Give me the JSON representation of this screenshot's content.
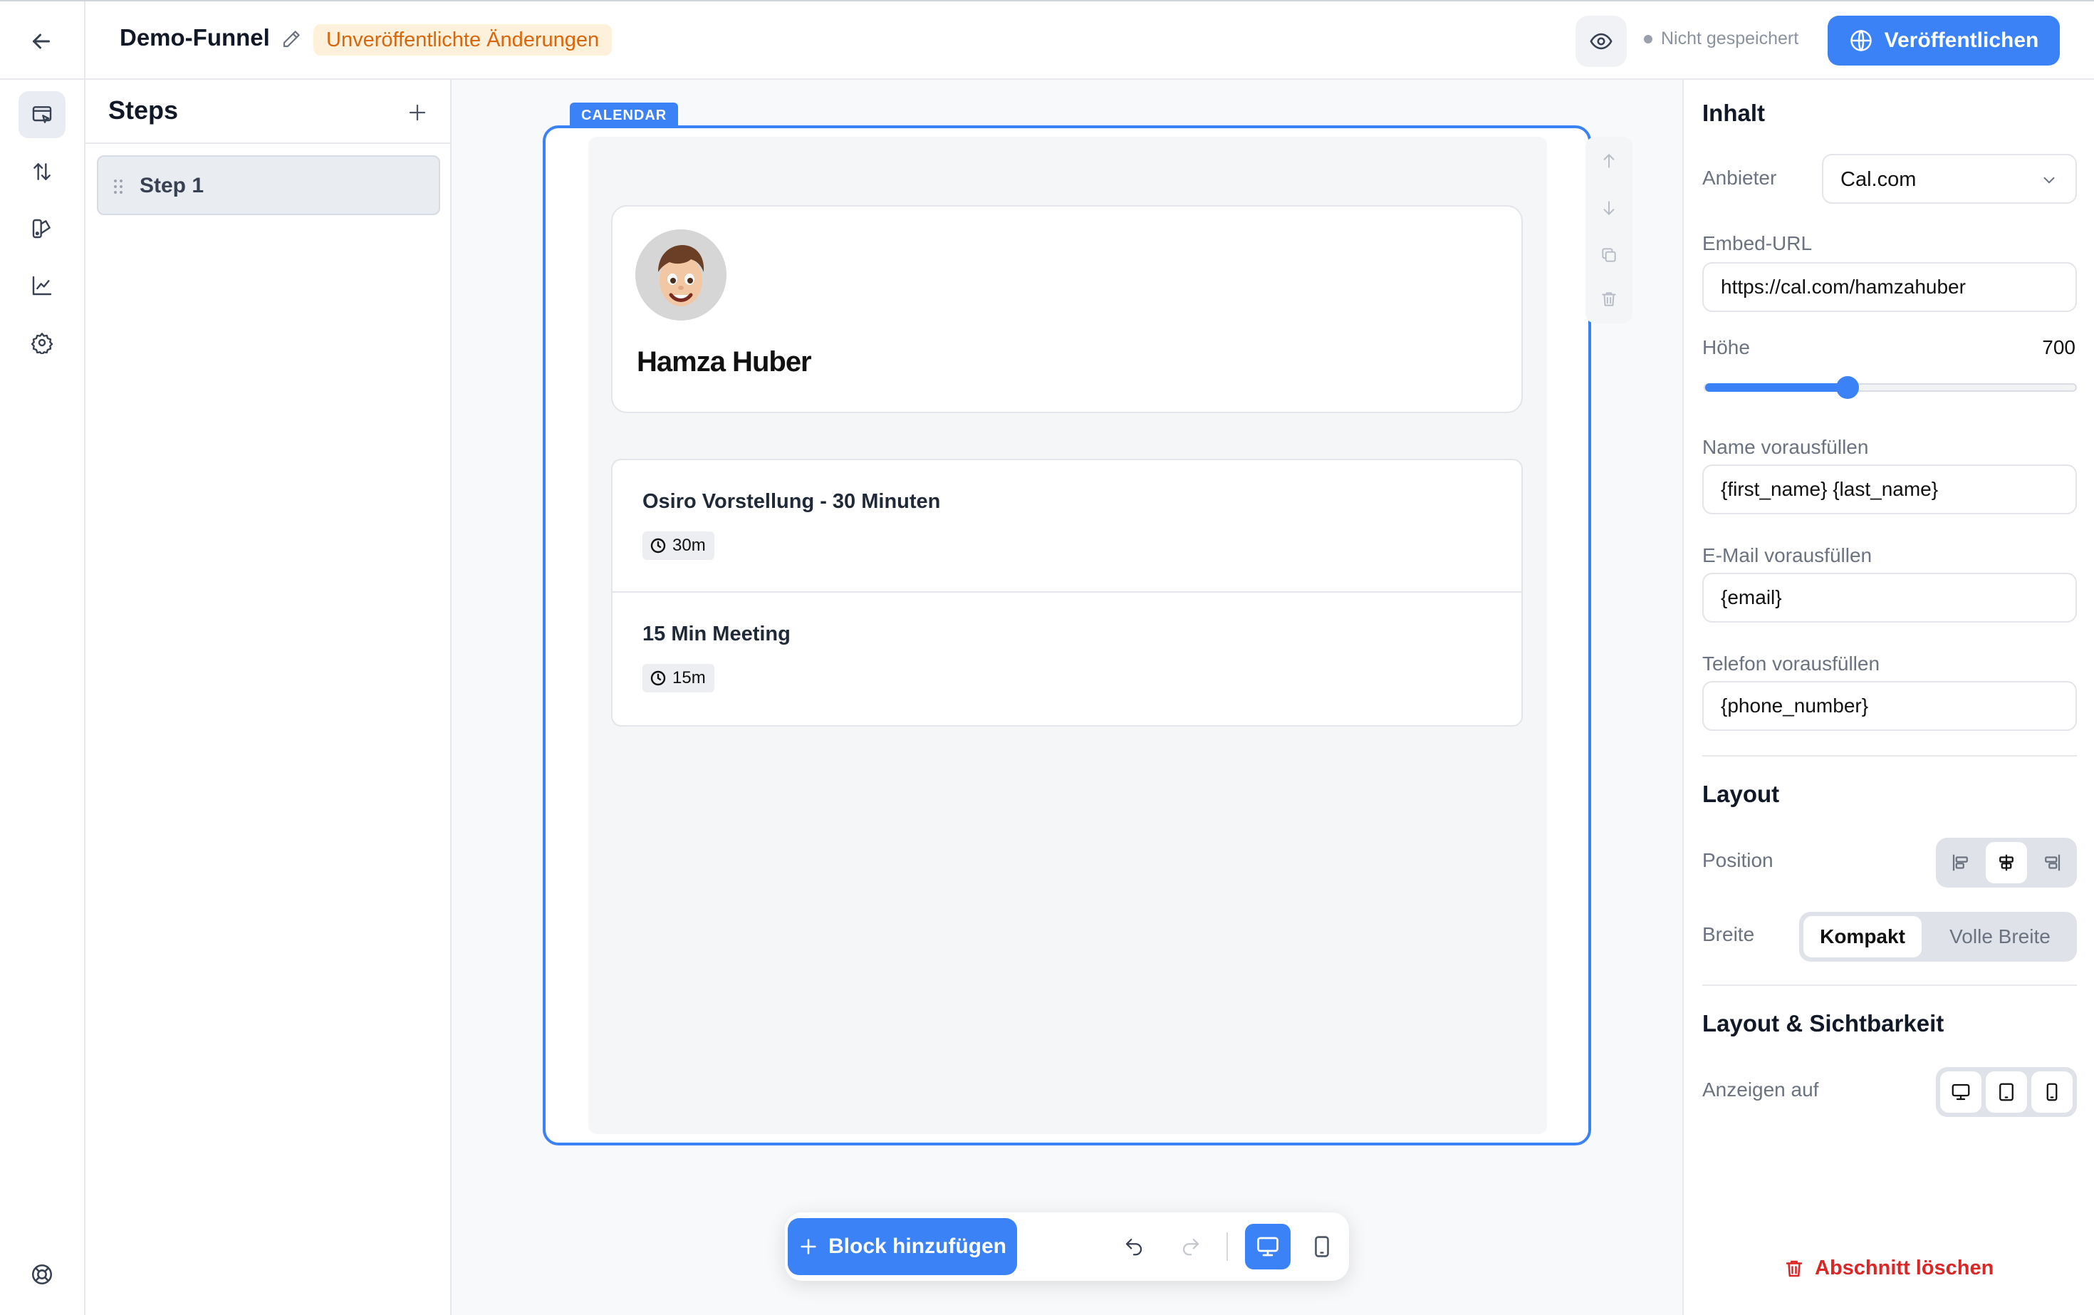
{
  "header": {
    "funnel_name": "Demo-Funnel",
    "unpublished_badge": "Unveröffentlichte Änderungen",
    "save_status": "Nicht gespeichert",
    "publish_label": "Veröffentlichen"
  },
  "steps": {
    "title": "Steps",
    "items": [
      {
        "label": "Step 1"
      }
    ]
  },
  "canvas": {
    "block_tag": "CALENDAR",
    "host_name": "Hamza Huber",
    "events": [
      {
        "title": "Osiro Vorstellung - 30 Minuten",
        "duration": "30m"
      },
      {
        "title": "15 Min Meeting",
        "duration": "15m"
      }
    ]
  },
  "toolbar": {
    "add_block_label": "Block hinzufügen"
  },
  "properties": {
    "content_title": "Inhalt",
    "provider_label": "Anbieter",
    "provider_value": "Cal.com",
    "embed_url_label": "Embed-URL",
    "embed_url_value": "https://cal.com/hamzahuber",
    "height_label": "Höhe",
    "height_value": "700",
    "height_fraction": 0.385,
    "name_label": "Name vorausfüllen",
    "name_value": "{first_name} {last_name}",
    "email_label": "E-Mail vorausfüllen",
    "email_value": "{email}",
    "phone_label": "Telefon vorausfüllen",
    "phone_value": "{phone_number}",
    "layout_title": "Layout",
    "position_label": "Position",
    "width_label": "Breite",
    "width_options": [
      "Kompakt",
      "Volle Breite"
    ],
    "visibility_title": "Layout & Sichtbarkeit",
    "show_on_label": "Anzeigen auf",
    "delete_section_label": "Abschnitt löschen"
  },
  "colors": {
    "accent": "#3b82f6",
    "badge_bg": "#fdf1dc",
    "badge_text": "#d9660b",
    "danger": "#dc2626"
  }
}
